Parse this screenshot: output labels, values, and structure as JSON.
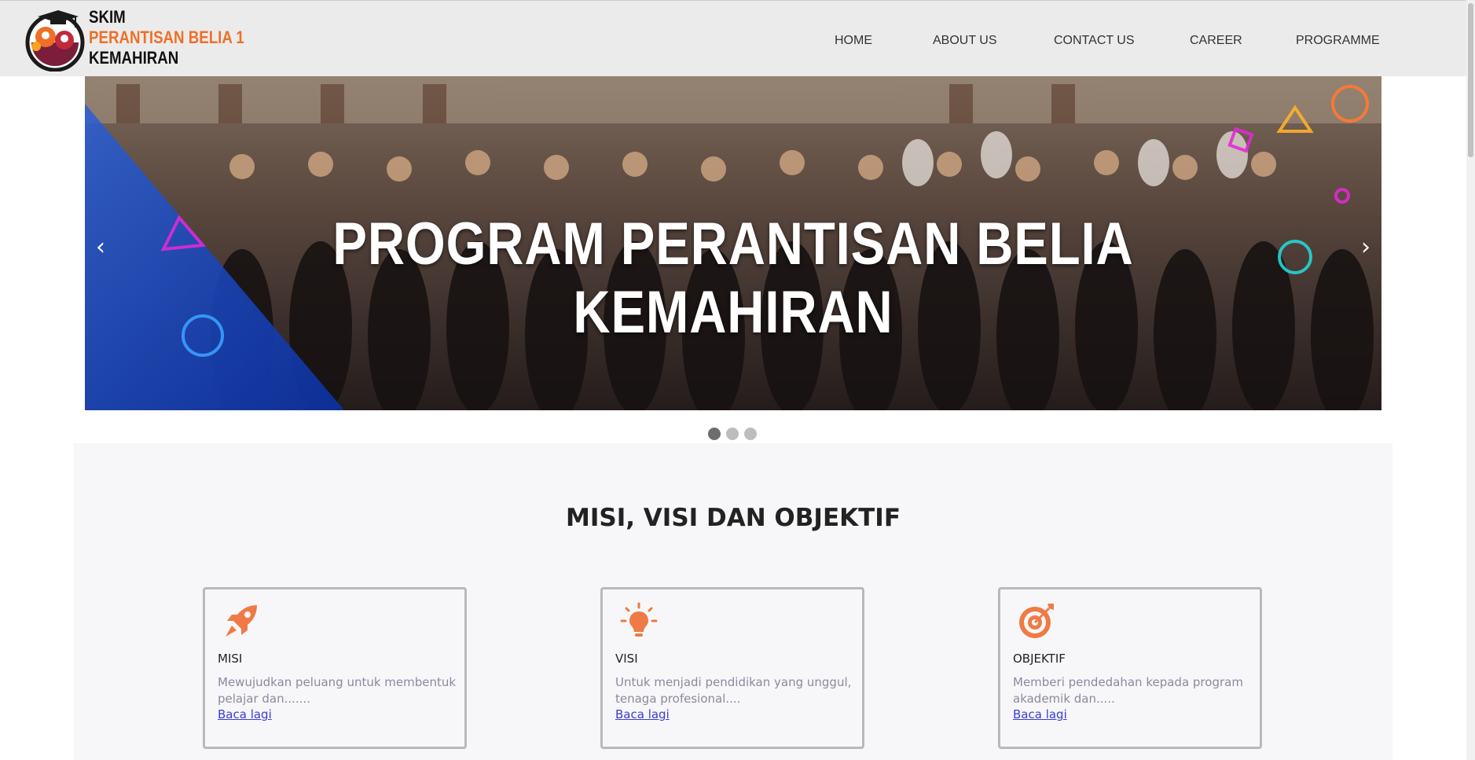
{
  "brand": {
    "line1": "SKIM",
    "line2": "PERANTISAN BELIA 1",
    "line3": "KEMAHIRAN",
    "accent_color": "#ef6f27"
  },
  "nav": {
    "items": [
      {
        "label": "HOME"
      },
      {
        "label": "ABOUT US"
      },
      {
        "label": "CONTACT US"
      },
      {
        "label": "CAREER"
      },
      {
        "label": "PROGRAMME"
      }
    ]
  },
  "carousel": {
    "title": "PROGRAM PERANTISAN BELIA KEMAHIRAN",
    "prev_icon": "‹",
    "next_icon": "›",
    "slide_count": 3,
    "active_slide": 1
  },
  "section": {
    "heading": "MISI, VISI DAN OBJEKTIF",
    "cards": [
      {
        "icon": "rocket-icon",
        "title": "MISI",
        "text": "Mewujudkan peluang untuk membentuk pelajar dan.......",
        "link": "Baca lagi"
      },
      {
        "icon": "lightbulb-icon",
        "title": "VISI",
        "text": "Untuk menjadi pendidikan yang unggul, tenaga profesional....",
        "link": "Baca lagi"
      },
      {
        "icon": "target-icon",
        "title": "OBJEKTIF",
        "text": "Memberi pendedahan kepada program akademik dan.....",
        "link": "Baca lagi"
      }
    ]
  },
  "colors": {
    "icon_orange": "#f07a45",
    "navbar_bg": "#ebebeb",
    "link_blue": "#3b3bd6"
  }
}
